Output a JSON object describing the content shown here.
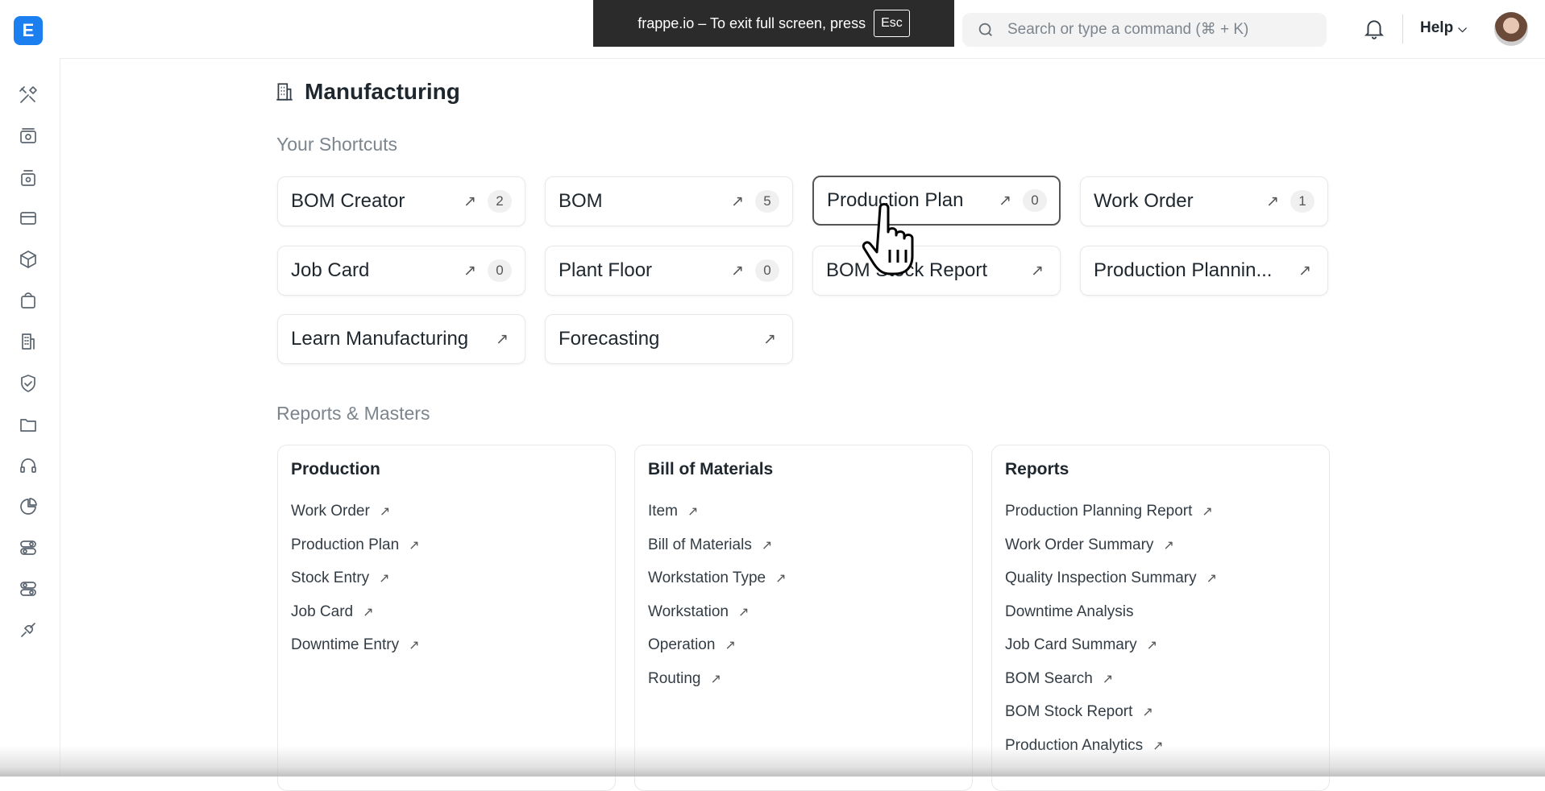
{
  "app": {
    "logo_letter": "E"
  },
  "sidebar": {
    "icons": [
      "tools-icon",
      "eye-icon",
      "cash-register-icon",
      "credit-card-icon",
      "package-icon",
      "shopping-bag-icon",
      "building-icon",
      "shield-check-icon",
      "folder-icon",
      "headset-icon",
      "pie-chart-icon",
      "toggle-icon",
      "toggle-alt-icon",
      "plug-icon"
    ]
  },
  "fullscreen_notice": {
    "text": "frappe.io – To exit full screen, press",
    "key": "Esc"
  },
  "search": {
    "placeholder": "Search or type a command (⌘ + K)"
  },
  "header": {
    "help_label": "Help"
  },
  "page": {
    "title": "Manufacturing"
  },
  "shortcuts_section": {
    "title": "Your Shortcuts"
  },
  "shortcuts": [
    {
      "label": "BOM Creator",
      "count": "2"
    },
    {
      "label": "BOM",
      "count": "5"
    },
    {
      "label": "Production Plan",
      "count": "0"
    },
    {
      "label": "Work Order",
      "count": "1"
    },
    {
      "label": "Job Card",
      "count": "0"
    },
    {
      "label": "Plant Floor",
      "count": "0"
    },
    {
      "label": "BOM Stock Report",
      "count": ""
    },
    {
      "label": "Production Plannin...",
      "count": ""
    },
    {
      "label": "Learn Manufacturing",
      "count": ""
    },
    {
      "label": "Forecasting",
      "count": ""
    }
  ],
  "reports_section": {
    "title": "Reports & Masters"
  },
  "cards": [
    {
      "title": "Production",
      "links": [
        "Work Order",
        "Production Plan",
        "Stock Entry",
        "Job Card",
        "Downtime Entry"
      ]
    },
    {
      "title": "Bill of Materials",
      "links": [
        "Item",
        "Bill of Materials",
        "Workstation Type",
        "Workstation",
        "Operation",
        "Routing"
      ]
    },
    {
      "title": "Reports",
      "links": [
        "Production Planning Report",
        "Work Order Summary",
        "Quality Inspection Summary",
        "Downtime Analysis",
        "Job Card Summary",
        "BOM Search",
        "BOM Stock Report",
        "Production Analytics"
      ]
    }
  ],
  "arrow_glyph": "↗"
}
